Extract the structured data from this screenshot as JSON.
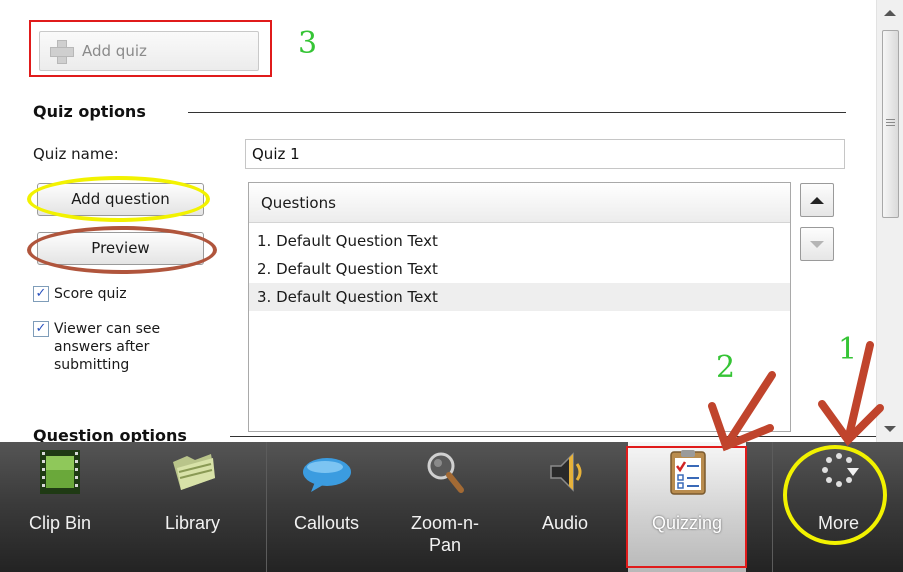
{
  "quiz": {
    "add_quiz_label": "Add quiz",
    "section_title": "Quiz options",
    "name_label": "Quiz name:",
    "name_value": "Quiz 1",
    "add_question_label": "Add question",
    "preview_label": "Preview",
    "score_quiz_label": "Score quiz",
    "score_quiz_checked": true,
    "viewer_answers_label": "Viewer can see answers after submitting",
    "viewer_answers_checked": true,
    "questions_header": "Questions",
    "questions": [
      "1. Default Question Text",
      "2. Default Question Text",
      "3. Default Question Text"
    ],
    "selected_question": 3,
    "question_options_title": "Question options"
  },
  "toolbar": {
    "tabs": [
      {
        "label": "Clip Bin",
        "icon": "film-strip-icon"
      },
      {
        "label": "Library",
        "icon": "folder-icon"
      },
      {
        "label": "Callouts",
        "icon": "speech-bubble-icon"
      },
      {
        "label": "Zoom-n-Pan",
        "icon": "magnifier-icon"
      },
      {
        "label": "Audio",
        "icon": "speaker-icon"
      },
      {
        "label": "Quizzing",
        "icon": "clipboard-checklist-icon",
        "selected": true
      },
      {
        "label": "More",
        "icon": "more-dots-icon"
      }
    ]
  },
  "annotations": {
    "numbers": [
      "1",
      "2",
      "3"
    ],
    "colors": {
      "box": "#e01b1b",
      "arrow": "#c0442c",
      "circle_yellow": "#f2f200",
      "circle_brown": "#b0553c",
      "number": "#35c435"
    }
  }
}
